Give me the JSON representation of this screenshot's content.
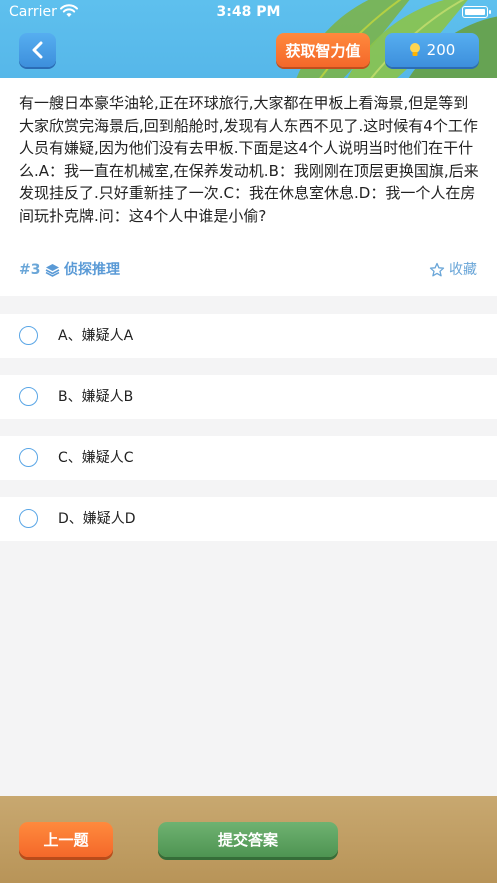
{
  "status_bar": {
    "carrier": "Carrier",
    "time": "3:48 PM"
  },
  "header": {
    "back_icon": "chevron-left-icon",
    "get_iq_label": "获取智力值",
    "score_icon": "lightbulb-icon",
    "score_value": "200"
  },
  "question": {
    "text": "有一艘日本豪华油轮,正在环球旅行,大家都在甲板上看海景,但是等到大家欣赏完海景后,回到船舱时,发现有人东西不见了.这时候有4个工作人员有嫌疑,因为他们没有去甲板.下面是这4个人说明当时他们在干什么.A：我一直在机械室,在保养发动机.B：我刚刚在顶层更换国旗,后来发现挂反了.只好重新挂了一次.C：我在休息室休息.D：我一个人在房间玩扑克牌.问：这4个人中谁是小偷?",
    "number": "#3",
    "category_icon": "layers-icon",
    "category": "侦探推理",
    "favorite_icon": "star-outline-icon",
    "favorite_label": "收藏"
  },
  "options": [
    {
      "label": "A、嫌疑人A"
    },
    {
      "label": "B、嫌疑人B"
    },
    {
      "label": "C、嫌疑人C"
    },
    {
      "label": "D、嫌疑人D"
    }
  ],
  "footer": {
    "prev_label": "上一题",
    "submit_label": "提交答案"
  },
  "colors": {
    "header_blue": "#5ec0ee",
    "accent_orange": "#f4682a",
    "accent_blue": "#3d8fdc",
    "submit_green": "#4e9452",
    "footer_tan": "#c8a870",
    "link_blue": "#6aa6d8"
  }
}
